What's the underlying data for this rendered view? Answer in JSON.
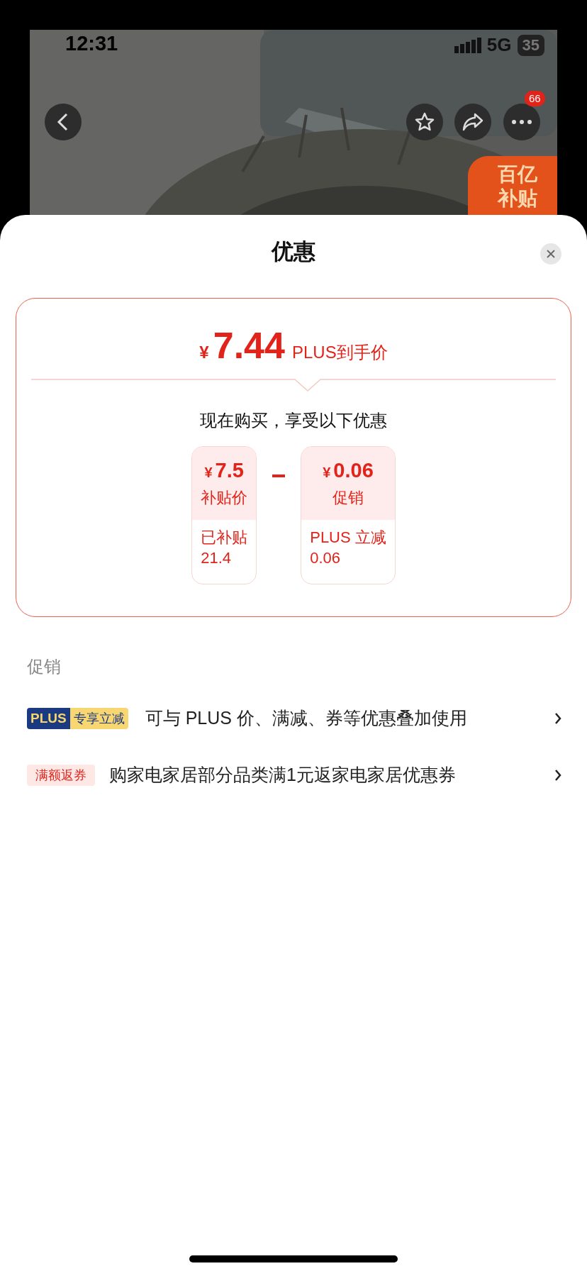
{
  "status_bar": {
    "time": "12:31",
    "network": "5G",
    "battery": "35"
  },
  "header": {
    "more_badge": "66",
    "promo_badge": [
      "百亿",
      "补贴"
    ]
  },
  "sheet": {
    "title": "优惠"
  },
  "price_card": {
    "currency": "¥",
    "price": "7.44",
    "price_label": "PLUS到手价",
    "subtitle": "现在购买，享受以下优惠",
    "items": [
      {
        "currency": "¥",
        "amount": "7.5",
        "label": "补贴价",
        "detail": [
          "已补贴",
          "21.4"
        ]
      },
      {
        "currency": "¥",
        "amount": "0.06",
        "label": "促销",
        "detail": [
          "PLUS 立减",
          "0.06"
        ]
      }
    ]
  },
  "promotions": {
    "heading": "促销",
    "rows": [
      {
        "kind": "plus",
        "tag": [
          "PLUS",
          "专享立减"
        ],
        "text": "可与 PLUS 价、满减、券等优惠叠加使用"
      },
      {
        "kind": "plain",
        "tag": [
          "满额返券"
        ],
        "text": "购家电家居部分品类满1元返家电家居优惠券"
      }
    ]
  }
}
